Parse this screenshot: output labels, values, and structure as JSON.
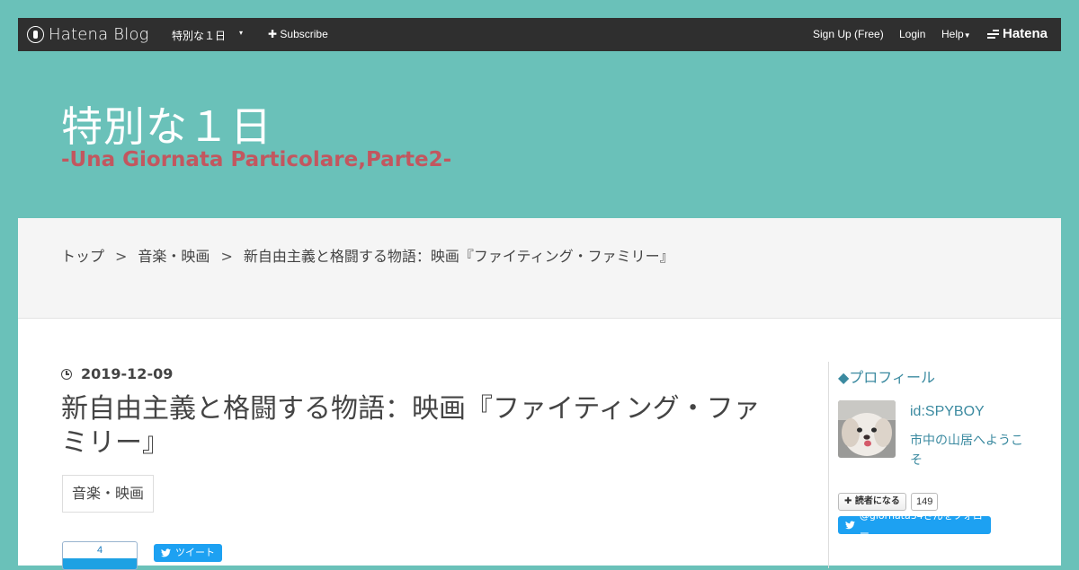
{
  "topbar": {
    "logo_text": "Hatena Blog",
    "blog_name": "特別な１日",
    "caret": "▾",
    "subscribe_label": "Subscribe",
    "signup_label": "Sign Up (Free)",
    "login_label": "Login",
    "help_label": "Help",
    "hatena_label": "Hatena"
  },
  "header": {
    "title": "特別な１日",
    "subtitle": "-Una Giornata Particolare,Parte2-"
  },
  "breadcrumb": {
    "items": [
      "トップ",
      "音楽・映画",
      "新自由主義と格闘する物語：映画『ファイティング・ファミリー』"
    ],
    "separator": ">"
  },
  "entry": {
    "date": "2019-12-09",
    "title": "新自由主義と格闘する物語：映画『ファイティング・ファミリー』",
    "category": "音楽・映画",
    "bookmark_count": "4",
    "tweet_label": "ツイート"
  },
  "sidebar": {
    "profile_title": "◆プロフィール",
    "user_id": "id:SPYBOY",
    "description": "市中の山居へようこそ",
    "reader_label": "読者になる",
    "reader_count": "149",
    "follow_label": "@giornata34さんをフォロー"
  },
  "colors": {
    "background": "#6ac1b9",
    "topbar": "#2f2f2f",
    "subtitle": "#c2575f",
    "accent_link": "#3b8aa0",
    "twitter": "#1da1f2"
  }
}
